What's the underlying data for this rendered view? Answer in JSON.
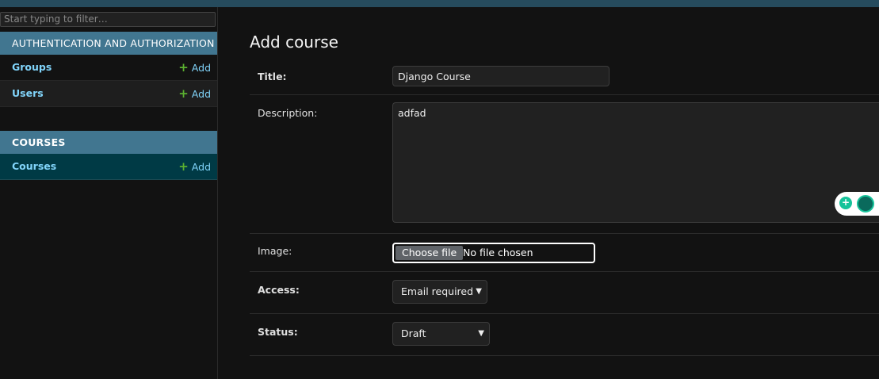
{
  "sidebar": {
    "filter_placeholder": "Start typing to filter…",
    "modules": [
      {
        "caption": "AUTHENTICATION AND AUTHORIZATION",
        "models": [
          {
            "name": "Groups",
            "add": "Add"
          },
          {
            "name": "Users",
            "add": "Add"
          }
        ]
      },
      {
        "caption": "COURSES",
        "models": [
          {
            "name": "Courses",
            "add": "Add"
          }
        ]
      }
    ]
  },
  "main": {
    "title": "Add course",
    "fields": {
      "title": {
        "label": "Title:",
        "value": "Django Course"
      },
      "description": {
        "label": "Description:",
        "value": "adfad"
      },
      "image": {
        "label": "Image:",
        "button": "Choose file",
        "status": "No file chosen"
      },
      "access": {
        "label": "Access:",
        "selected": "Email required"
      },
      "status": {
        "label": "Status:",
        "selected": "Draft"
      }
    }
  },
  "colors": {
    "header": "#264b5d",
    "module_caption": "#417690",
    "link": "#81d4fa",
    "add_icon": "#5bb030",
    "selected_row": "#003a45"
  },
  "icons": [
    "plus-icon",
    "chevron-down-icon",
    "grammar-assistant-icon"
  ]
}
